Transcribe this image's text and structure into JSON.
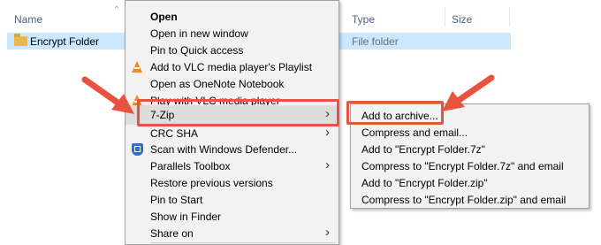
{
  "explorer": {
    "columns": {
      "name": "Name",
      "type": "Type",
      "size": "Size"
    },
    "file": {
      "name": "Encrypt Folder",
      "type": "File folder"
    }
  },
  "context_menu": {
    "items": [
      {
        "label": "Open",
        "bold": true
      },
      {
        "label": "Open in new window"
      },
      {
        "label": "Pin to Quick access"
      },
      {
        "label": "Add to VLC media player's Playlist",
        "icon": "vlc-icon"
      },
      {
        "label": "Open as OneNote Notebook"
      },
      {
        "label": "Play with VLC media player",
        "icon": "vlc-icon"
      },
      {
        "label": "7-Zip",
        "submenu": true
      },
      {
        "label": "CRC SHA",
        "submenu": true
      },
      {
        "label": "Scan with Windows Defender...",
        "icon": "shield-icon"
      },
      {
        "label": "Parallels Toolbox",
        "submenu": true
      },
      {
        "label": "Restore previous versions"
      },
      {
        "label": "Pin to Start"
      },
      {
        "label": "Show in Finder"
      },
      {
        "label": "Share on",
        "submenu": true
      }
    ]
  },
  "seven_zip_submenu": {
    "items": [
      {
        "label": "Add to archive..."
      },
      {
        "label": "Compress and email..."
      },
      {
        "label": "Add to \"Encrypt Folder.7z\""
      },
      {
        "label": "Compress to \"Encrypt Folder.7z\" and email"
      },
      {
        "label": "Add to \"Encrypt Folder.zip\""
      },
      {
        "label": "Compress to \"Encrypt Folder.zip\" and email"
      }
    ]
  },
  "colors": {
    "annotation": "#e8533f",
    "selection": "#cce8ff",
    "menu_bg": "#f2f2f2"
  }
}
